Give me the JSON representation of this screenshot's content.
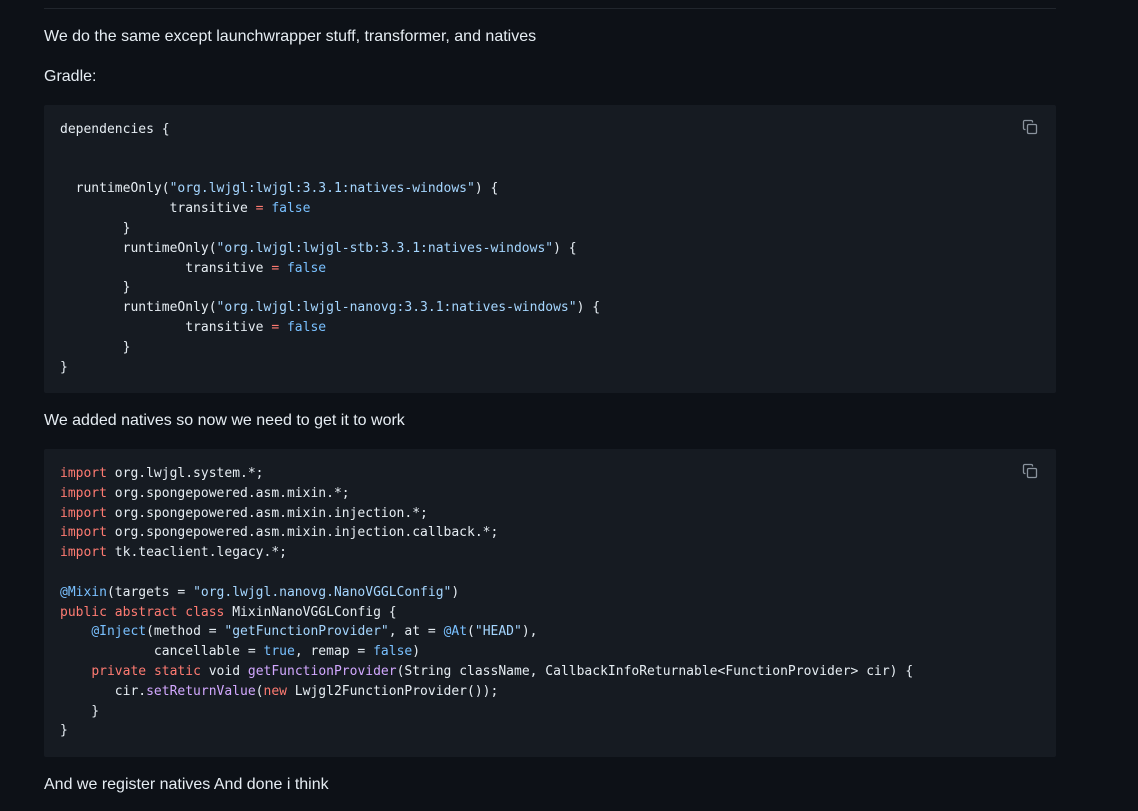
{
  "paragraphs": {
    "intro": "We do the same except launchwrapper stuff, transformer, and natives",
    "gradle_label": "Gradle:",
    "natives_note": "We added natives so now we need to get it to work",
    "outro": "And we register natives And done i think"
  },
  "icons": {
    "copy": "copy-icon"
  },
  "colors": {
    "background": "#0d1117",
    "code_background": "#161b22",
    "text": "#e6edf3",
    "keyword": "#ff7b72",
    "string": "#a5d6ff",
    "constant": "#79c0ff",
    "function": "#d2a8ff"
  },
  "gradle_code": {
    "lines": [
      [
        {
          "t": "dependencies {"
        }
      ],
      [],
      [],
      [
        {
          "t": "  runtimeOnly("
        },
        {
          "t": "\"org.lwjgl:lwjgl:3.3.1:natives-windows\"",
          "c": "str"
        },
        {
          "t": ") {"
        }
      ],
      [
        {
          "t": "              transitive "
        },
        {
          "t": "=",
          "c": "op"
        },
        {
          "t": " "
        },
        {
          "t": "false",
          "c": "bool"
        }
      ],
      [
        {
          "t": "        }"
        }
      ],
      [
        {
          "t": "        runtimeOnly("
        },
        {
          "t": "\"org.lwjgl:lwjgl-stb:3.3.1:natives-windows\"",
          "c": "str"
        },
        {
          "t": ") {"
        }
      ],
      [
        {
          "t": "                transitive "
        },
        {
          "t": "=",
          "c": "op"
        },
        {
          "t": " "
        },
        {
          "t": "false",
          "c": "bool"
        }
      ],
      [
        {
          "t": "        }"
        }
      ],
      [
        {
          "t": "        runtimeOnly("
        },
        {
          "t": "\"org.lwjgl:lwjgl-nanovg:3.3.1:natives-windows\"",
          "c": "str"
        },
        {
          "t": ") {"
        }
      ],
      [
        {
          "t": "                transitive "
        },
        {
          "t": "=",
          "c": "op"
        },
        {
          "t": " "
        },
        {
          "t": "false",
          "c": "bool"
        }
      ],
      [
        {
          "t": "        }"
        }
      ],
      [
        {
          "t": "}"
        }
      ]
    ]
  },
  "java_code": {
    "lines": [
      [
        {
          "t": "import",
          "c": "kw"
        },
        {
          "t": " org.lwjgl.system.*;"
        }
      ],
      [
        {
          "t": "import",
          "c": "kw"
        },
        {
          "t": " org.spongepowered.asm.mixin.*;"
        }
      ],
      [
        {
          "t": "import",
          "c": "kw"
        },
        {
          "t": " org.spongepowered.asm.mixin.injection.*;"
        }
      ],
      [
        {
          "t": "import",
          "c": "kw"
        },
        {
          "t": " org.spongepowered.asm.mixin.injection.callback.*;"
        }
      ],
      [
        {
          "t": "import",
          "c": "kw"
        },
        {
          "t": " tk.teaclient.legacy.*;"
        }
      ],
      [],
      [
        {
          "t": "@Mixin",
          "c": "ann"
        },
        {
          "t": "(targets = "
        },
        {
          "t": "\"org.lwjgl.nanovg.NanoVGGLConfig\"",
          "c": "str"
        },
        {
          "t": ")"
        }
      ],
      [
        {
          "t": "public",
          "c": "kw"
        },
        {
          "t": " "
        },
        {
          "t": "abstract",
          "c": "kw"
        },
        {
          "t": " "
        },
        {
          "t": "class",
          "c": "kw"
        },
        {
          "t": " MixinNanoVGGLConfig {"
        }
      ],
      [
        {
          "t": "    "
        },
        {
          "t": "@Inject",
          "c": "ann"
        },
        {
          "t": "(method = "
        },
        {
          "t": "\"getFunctionProvider\"",
          "c": "str"
        },
        {
          "t": ", at = "
        },
        {
          "t": "@At",
          "c": "ann"
        },
        {
          "t": "("
        },
        {
          "t": "\"HEAD\"",
          "c": "str"
        },
        {
          "t": "),"
        }
      ],
      [
        {
          "t": "            cancellable = "
        },
        {
          "t": "true",
          "c": "bool"
        },
        {
          "t": ", remap = "
        },
        {
          "t": "false",
          "c": "bool"
        },
        {
          "t": ")"
        }
      ],
      [
        {
          "t": "    "
        },
        {
          "t": "private",
          "c": "kw"
        },
        {
          "t": " "
        },
        {
          "t": "static",
          "c": "kw"
        },
        {
          "t": " void "
        },
        {
          "t": "getFunctionProvider",
          "c": "fn"
        },
        {
          "t": "(String className, CallbackInfoReturnable<FunctionProvider> cir) {"
        }
      ],
      [
        {
          "t": "       cir."
        },
        {
          "t": "setReturnValue",
          "c": "fn"
        },
        {
          "t": "("
        },
        {
          "t": "new",
          "c": "kw"
        },
        {
          "t": " Lwjgl2FunctionProvider());"
        }
      ],
      [
        {
          "t": "    }"
        }
      ],
      [
        {
          "t": "}"
        }
      ]
    ]
  }
}
